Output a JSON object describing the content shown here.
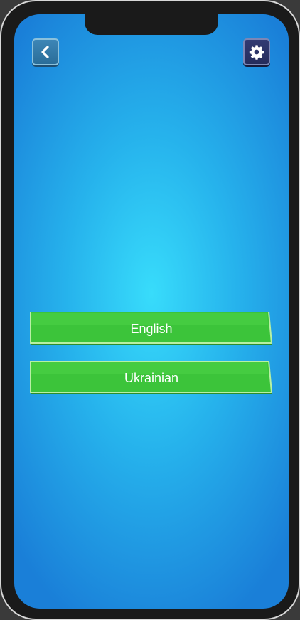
{
  "header": {
    "back_icon": "chevron-left-icon",
    "settings_icon": "gear-icon"
  },
  "languages": [
    {
      "label": "English"
    },
    {
      "label": "Ukrainian"
    }
  ],
  "colors": {
    "background_center": "#38dcfb",
    "background_edge": "#1a7fd8",
    "button_green": "#3cc43a",
    "back_button": "#3a80b0",
    "settings_button": "#2b3266"
  }
}
